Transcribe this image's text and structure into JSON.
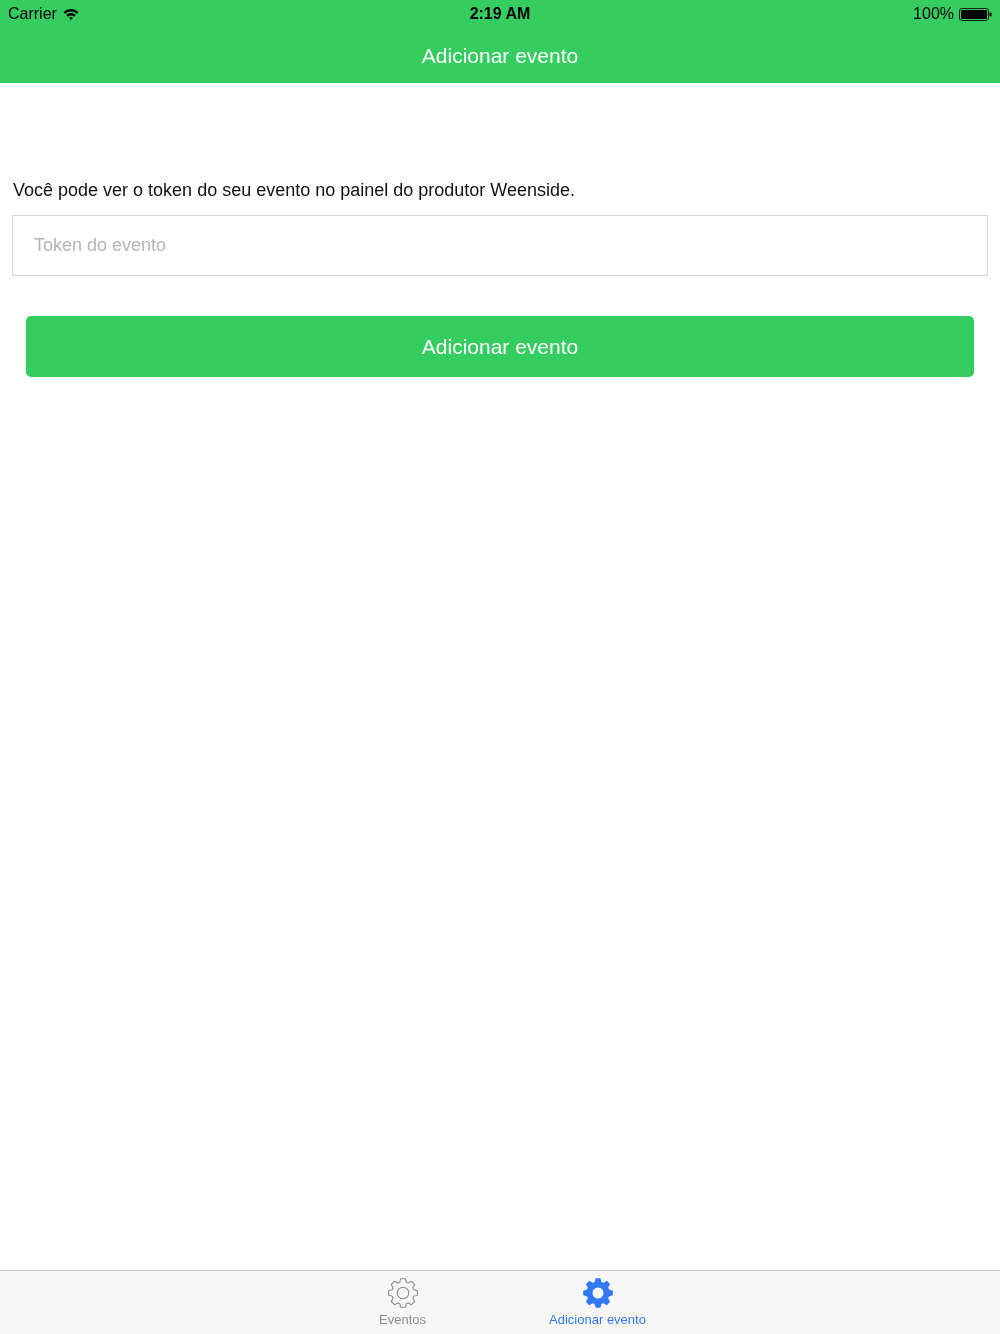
{
  "status_bar": {
    "carrier": "Carrier",
    "time": "2:19 AM",
    "battery": "100%"
  },
  "nav_bar": {
    "title": "Adicionar evento"
  },
  "form": {
    "hint": "Você pode ver o token do seu evento no painel do produtor Weenside.",
    "token_field": {
      "placeholder": "Token do evento"
    },
    "submit_button": "Adicionar evento"
  },
  "tab_bar": {
    "tabs": [
      {
        "label": "Eventos",
        "selected": false
      },
      {
        "label": "Adicionar evento",
        "selected": true
      }
    ]
  }
}
